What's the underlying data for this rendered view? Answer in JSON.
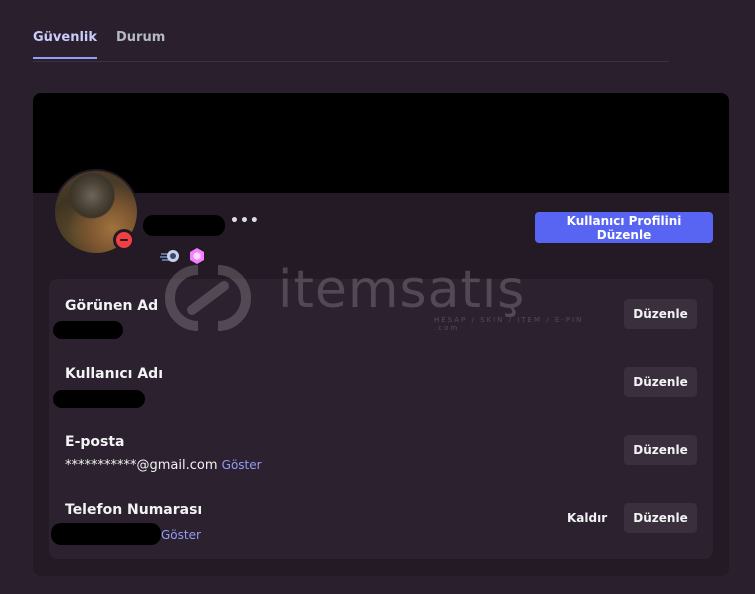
{
  "tabs": [
    {
      "label": "Güvenlik",
      "active": true
    },
    {
      "label": "Durum",
      "active": false
    }
  ],
  "profile": {
    "more_icon": "more-horizontal-icon",
    "status": "do-not-disturb",
    "edit_profile_label": "Kullanıcı Profilini Düzenle",
    "badges": [
      "nitro-badge-icon",
      "boost-badge-icon"
    ]
  },
  "account_rows": [
    {
      "label": "Görünen Ad",
      "value": "",
      "reveal": "",
      "edit": "Düzenle",
      "remove": ""
    },
    {
      "label": "Kullanıcı Adı",
      "value": "",
      "reveal": "",
      "edit": "Düzenle",
      "remove": ""
    },
    {
      "label": "E-posta",
      "value": "***********@gmail.com",
      "reveal": "Göster",
      "edit": "Düzenle",
      "remove": ""
    },
    {
      "label": "Telefon Numarası",
      "value": "",
      "reveal": "Göster",
      "edit": "Düzenle",
      "remove": "Kaldır"
    }
  ],
  "watermark": {
    "text": "itemsatış",
    "sub": "HESAP / SKIN / ITEM / E-PIN .com"
  },
  "colors": {
    "accent": "#5865f2",
    "dnd": "#f23f43",
    "link": "#949cf7",
    "background": "#2a1f2d"
  }
}
